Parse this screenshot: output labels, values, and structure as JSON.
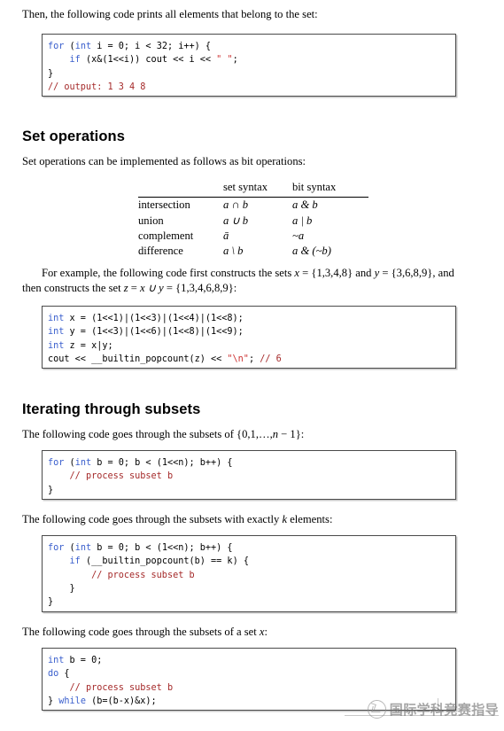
{
  "document": {
    "intro_paragraph": "Then, the following code prints all elements that belong to the set:",
    "code_print_elements": {
      "lines": [
        [
          {
            "t": "for ",
            "c": "kw"
          },
          {
            "t": "(",
            "c": "plain"
          },
          {
            "t": "int",
            "c": "kw"
          },
          {
            "t": " i = 0; i < 32; i++) {",
            "c": "plain"
          }
        ],
        [
          {
            "t": "    ",
            "c": "plain"
          },
          {
            "t": "if",
            "c": "kw"
          },
          {
            "t": " (x&(1<<i)) cout << i << ",
            "c": "plain"
          },
          {
            "t": "\" \"",
            "c": "str"
          },
          {
            "t": ";",
            "c": "plain"
          }
        ],
        [
          {
            "t": "}",
            "c": "plain"
          }
        ],
        [
          {
            "t": "// output: 1 3 4 8",
            "c": "cmt"
          }
        ]
      ]
    },
    "section_set_operations": {
      "heading": "Set operations",
      "paragraph": "Set operations can be implemented as follows as bit operations:",
      "table": {
        "columns": [
          "",
          "set syntax",
          "bit syntax"
        ],
        "rows": [
          {
            "name": "intersection",
            "set_syntax": "a ∩ b",
            "bit_syntax": "a & b"
          },
          {
            "name": "union",
            "set_syntax": "a ∪ b",
            "bit_syntax": "a | b"
          },
          {
            "name": "complement",
            "set_syntax": "ā",
            "bit_syntax": "~a"
          },
          {
            "name": "difference",
            "set_syntax": "a \\ b",
            "bit_syntax": "a & (~b)"
          }
        ]
      },
      "example_paragraph_line1_a": "For example, the following code first constructs the sets ",
      "example_paragraph_line1_x": "x",
      "example_paragraph_line1_b": " = {1,3,4,8} and",
      "example_paragraph_line2_y": "y",
      "example_paragraph_line2_a": " = {3,6,8,9}, and then constructs the set ",
      "example_paragraph_line2_z": "z",
      "example_paragraph_line2_b": " = ",
      "example_paragraph_line2_xy": "x ∪ y",
      "example_paragraph_line2_c": " = {1,3,4,6,8,9}:",
      "code_construct_sets": {
        "lines": [
          [
            {
              "t": "int",
              "c": "kw"
            },
            {
              "t": " x = (1<<1)|(1<<3)|(1<<4)|(1<<8);",
              "c": "plain"
            }
          ],
          [
            {
              "t": "int",
              "c": "kw"
            },
            {
              "t": " y = (1<<3)|(1<<6)|(1<<8)|(1<<9);",
              "c": "plain"
            }
          ],
          [
            {
              "t": "int",
              "c": "kw"
            },
            {
              "t": " z = x|y;",
              "c": "plain"
            }
          ],
          [
            {
              "t": "cout << __builtin_popcount(z) << ",
              "c": "plain"
            },
            {
              "t": "\"\\n\"",
              "c": "str"
            },
            {
              "t": "; ",
              "c": "plain"
            },
            {
              "t": "// 6",
              "c": "cmt"
            }
          ]
        ]
      }
    },
    "section_iterating_subsets": {
      "heading": "Iterating through subsets",
      "paragraph1_a": "The following code goes through the subsets of {0,1,…,",
      "paragraph1_n": "n",
      "paragraph1_b": " − 1}:",
      "code_all_subsets": {
        "lines": [
          [
            {
              "t": "for ",
              "c": "kw"
            },
            {
              "t": "(",
              "c": "plain"
            },
            {
              "t": "int",
              "c": "kw"
            },
            {
              "t": " b = 0; b < (1<<n); b++) {",
              "c": "plain"
            }
          ],
          [
            {
              "t": "    ",
              "c": "plain"
            },
            {
              "t": "// process subset b",
              "c": "cmt"
            }
          ],
          [
            {
              "t": "}",
              "c": "plain"
            }
          ]
        ]
      },
      "paragraph2_a": "The following code goes through the subsets with exactly ",
      "paragraph2_k": "k",
      "paragraph2_b": " elements:",
      "code_k_subsets": {
        "lines": [
          [
            {
              "t": "for ",
              "c": "kw"
            },
            {
              "t": "(",
              "c": "plain"
            },
            {
              "t": "int",
              "c": "kw"
            },
            {
              "t": " b = 0; b < (1<<n); b++) {",
              "c": "plain"
            }
          ],
          [
            {
              "t": "    ",
              "c": "plain"
            },
            {
              "t": "if",
              "c": "kw"
            },
            {
              "t": " (__builtin_popcount(b) == k) {",
              "c": "plain"
            }
          ],
          [
            {
              "t": "        ",
              "c": "plain"
            },
            {
              "t": "// process subset b",
              "c": "cmt"
            }
          ],
          [
            {
              "t": "    }",
              "c": "plain"
            }
          ],
          [
            {
              "t": "}",
              "c": "plain"
            }
          ]
        ]
      },
      "paragraph3_a": "The following code goes through the subsets of a set ",
      "paragraph3_x": "x",
      "paragraph3_b": ":",
      "code_subsets_of_x": {
        "lines": [
          [
            {
              "t": "int",
              "c": "kw"
            },
            {
              "t": " b = 0;",
              "c": "plain"
            }
          ],
          [
            {
              "t": "do ",
              "c": "kw"
            },
            {
              "t": "{",
              "c": "plain"
            }
          ],
          [
            {
              "t": "    ",
              "c": "plain"
            },
            {
              "t": "// process subset b",
              "c": "cmt"
            }
          ],
          [
            {
              "t": "} ",
              "c": "plain"
            },
            {
              "t": "while",
              "c": "kw"
            },
            {
              "t": " (b=(b-x)&x);",
              "c": "plain"
            }
          ]
        ]
      }
    },
    "watermark": {
      "text": "国际学科竞赛指导",
      "logo_icon": "circle-check-logo-icon"
    },
    "colors": {
      "keyword": "#3a5fcd",
      "comment": "#a52a2a",
      "string": "#cd3333",
      "text": "#000000",
      "code_border": "#4a4a4a",
      "watermark": "#6f6f6f"
    }
  }
}
